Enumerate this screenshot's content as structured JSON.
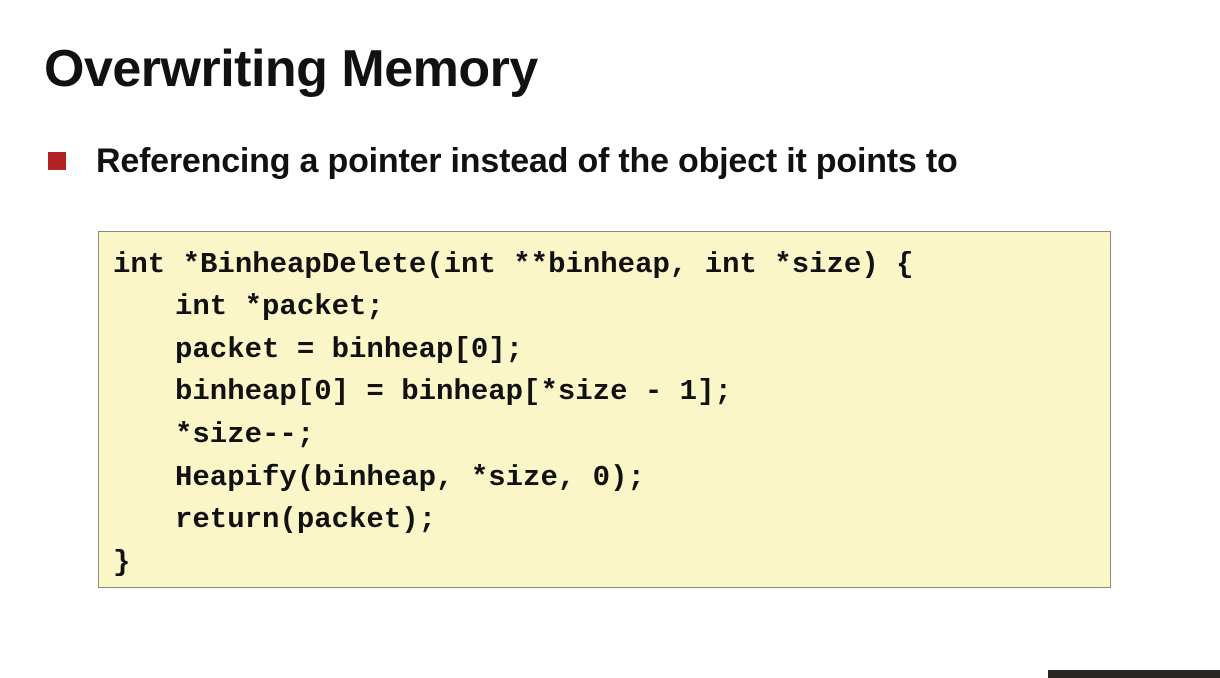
{
  "slide": {
    "title": "Overwriting Memory",
    "bullet": "Referencing a pointer instead of the object it points to",
    "colors": {
      "bullet": "#b22222",
      "code_background": "#fbf6c8"
    }
  },
  "code": {
    "lines": [
      "int *BinheapDelete(int **binheap, int *size) {",
      "int *packet;",
      "packet = binheap[0];",
      "binheap[0] = binheap[*size - 1];",
      "*size--;",
      "Heapify(binheap, *size, 0);",
      "return(packet);",
      "}"
    ]
  }
}
